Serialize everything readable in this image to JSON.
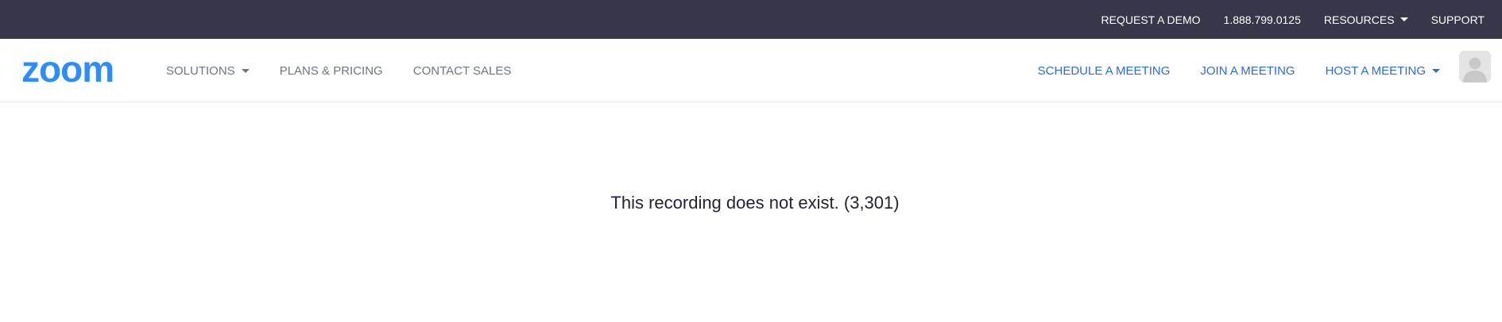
{
  "topbar": {
    "request_demo": "REQUEST A DEMO",
    "phone": "1.888.799.0125",
    "resources": "RESOURCES",
    "support": "SUPPORT"
  },
  "navbar": {
    "logo_text": "zoom",
    "solutions": "SOLUTIONS",
    "plans_pricing": "PLANS & PRICING",
    "contact_sales": "CONTACT SALES",
    "schedule_meeting": "SCHEDULE A MEETING",
    "join_meeting": "JOIN A MEETING",
    "host_meeting": "HOST A MEETING"
  },
  "main": {
    "message": "This recording does not exist. (3,301)"
  },
  "colors": {
    "topbar_bg": "#373749",
    "brand_blue": "#2d8cff",
    "link_blue": "#2d6bd6",
    "nav_gray": "#6e7680",
    "text_dark": "#232333"
  },
  "icons": {
    "resources_caret": "caret-down-icon",
    "solutions_caret": "caret-down-icon",
    "host_caret": "caret-down-icon",
    "avatar": "user-avatar-icon"
  }
}
